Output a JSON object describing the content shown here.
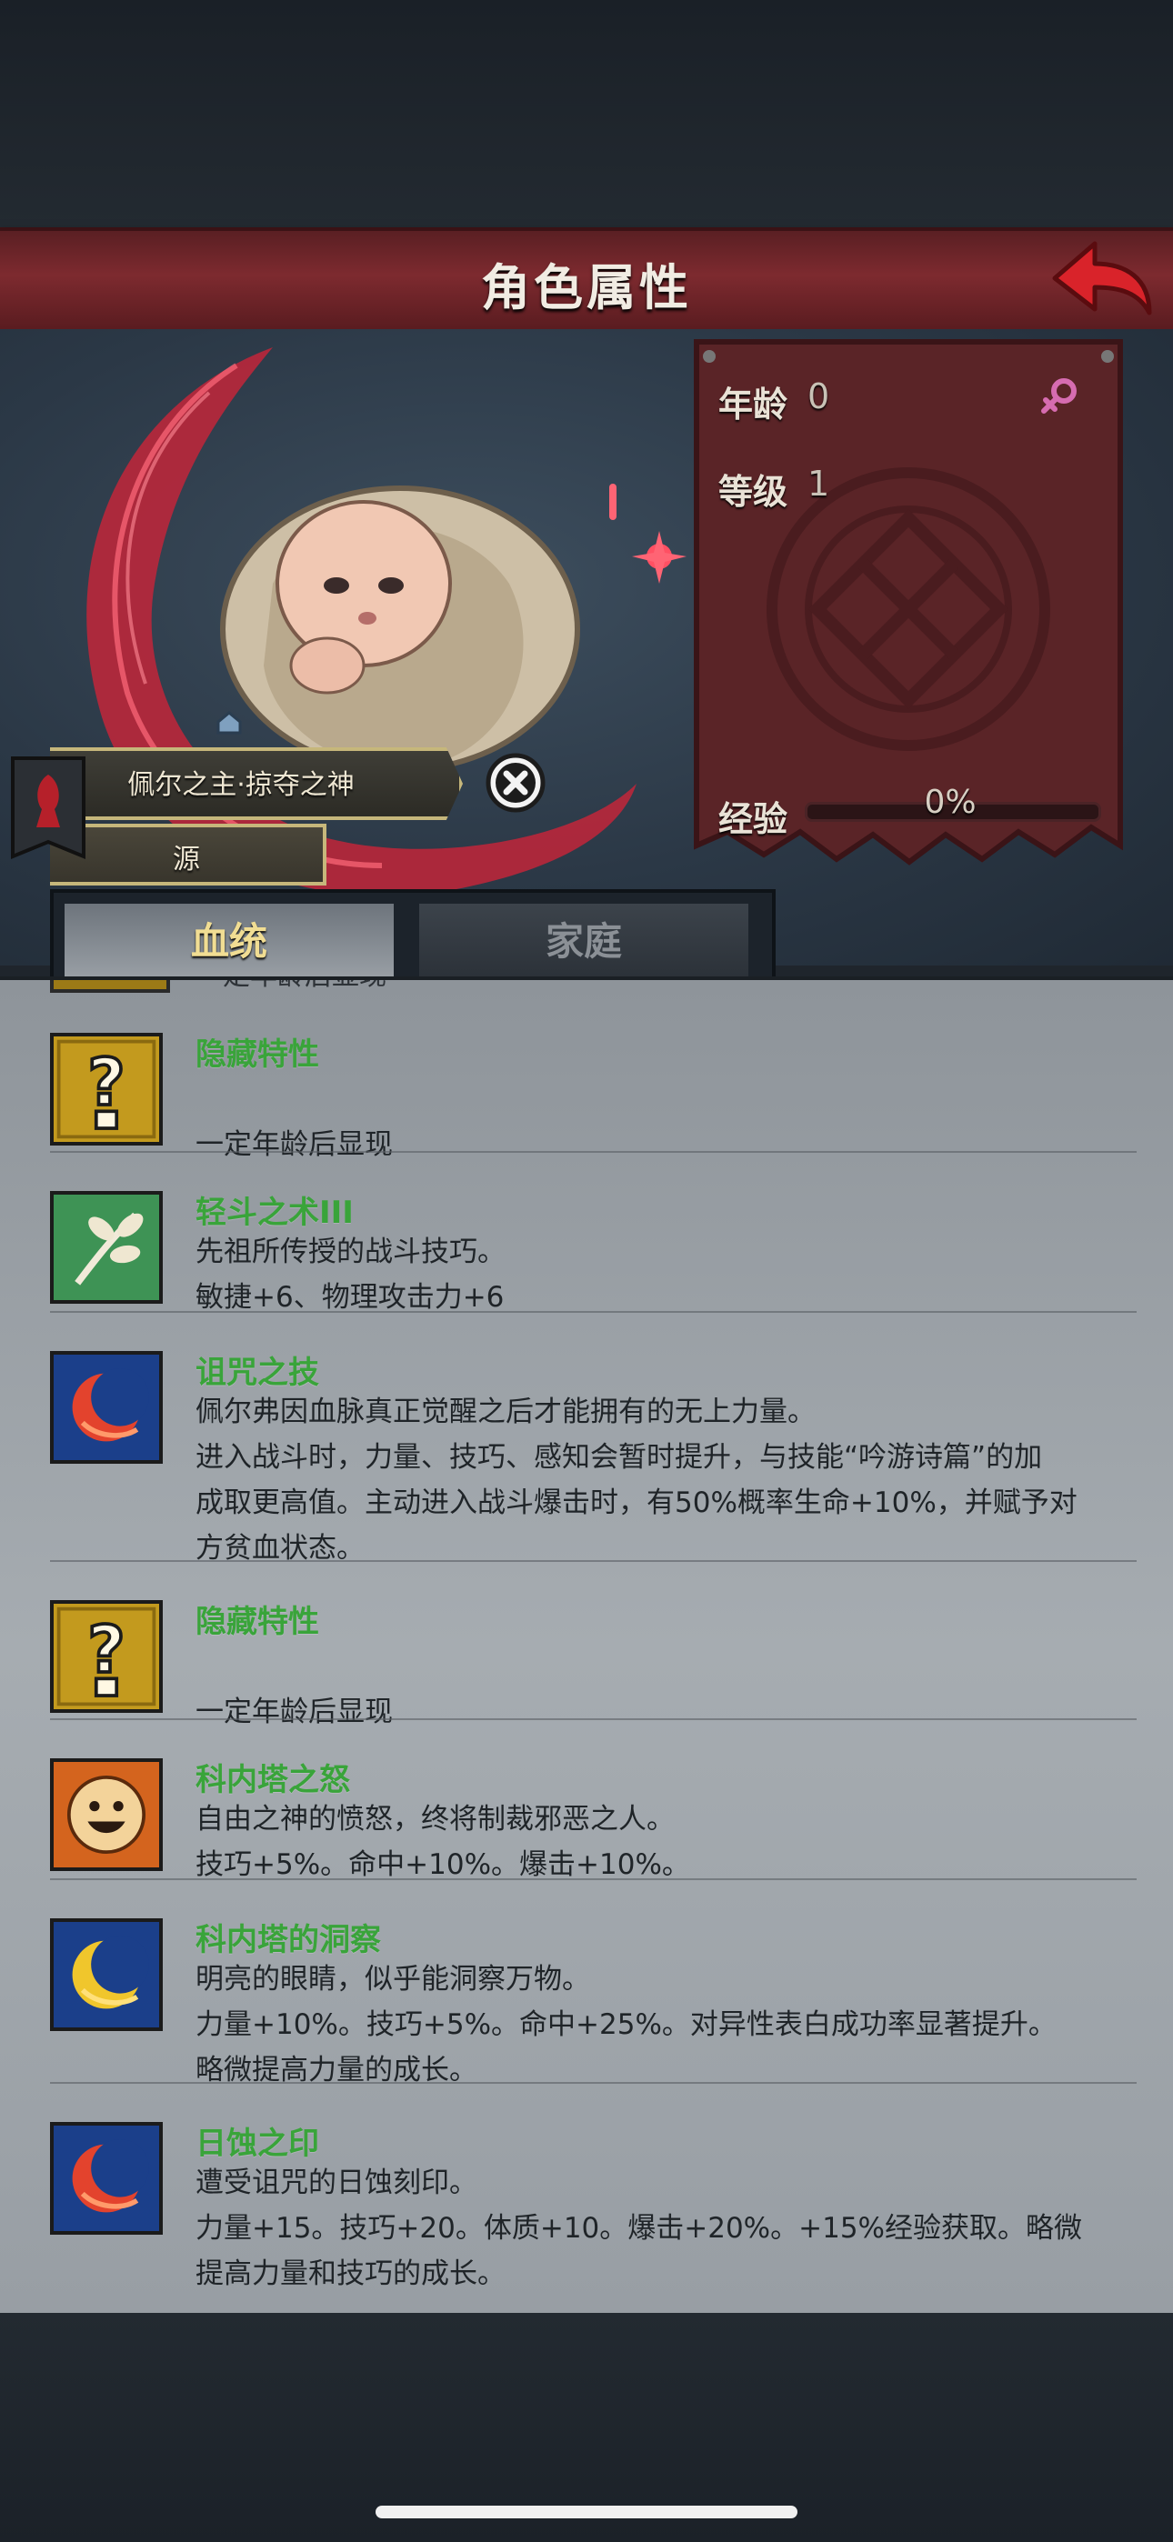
{
  "header": {
    "title": "角色属性"
  },
  "stats": {
    "age_label": "年龄",
    "age_value": "0",
    "level_label": "等级",
    "level_value": "1",
    "exp_label": "经验",
    "exp_percent": "0%",
    "exp_fraction": 0
  },
  "character": {
    "name": "佩尔之主·掠夺之神",
    "source": "源"
  },
  "tabs": [
    {
      "label": "血统",
      "active": true
    },
    {
      "label": "家庭",
      "active": false
    }
  ],
  "partial_entry_text": "一定年龄后显现",
  "traits": [
    {
      "icon": "question-icon",
      "title": "隐藏特性",
      "lines": [
        "",
        "一定年龄后显现"
      ]
    },
    {
      "icon": "branch-icon",
      "title": "轻斗之术III",
      "lines": [
        "先祖所传授的战斗技巧。",
        "敏捷+6、物理攻击力+6"
      ]
    },
    {
      "icon": "red-crescent-icon",
      "title": "诅咒之技",
      "lines": [
        "佩尔弗因血脉真正觉醒之后才能拥有的无上力量。",
        "进入战斗时，力量、技巧、感知会暂时提升，与技能“吟游诗篇”的加",
        "成取更高值。主动进入战斗爆击时，有50%概率生命+10%，并赋予对",
        "方贫血状态。"
      ]
    },
    {
      "icon": "question-icon",
      "title": "隐藏特性",
      "lines": [
        "",
        "一定年龄后显现"
      ]
    },
    {
      "icon": "smiling-sun-icon",
      "title": "科内塔之怒",
      "lines": [
        "自由之神的愤怒，终将制裁邪恶之人。",
        "技巧+5%。命中+10%。爆击+10%。"
      ]
    },
    {
      "icon": "yellow-crescent-icon",
      "title": "科内塔的洞察",
      "lines": [
        "明亮的眼睛，似乎能洞察万物。",
        "力量+10%。技巧+5%。命中+25%。对异性表白成功率显著提升。",
        "略微提高力量的成长。"
      ]
    },
    {
      "icon": "red-crescent-icon",
      "title": "日蚀之印",
      "lines": [
        "遭受诅咒的日蚀刻印。",
        "力量+15。技巧+20。体质+10。爆击+20%。+15%经验获取。略微",
        "提高力量和技巧的成长。"
      ]
    }
  ],
  "colors": {
    "header_red": "#7d2a2f",
    "trait_title_green": "#39a43a",
    "tab_active_text": "#f1dd93"
  }
}
